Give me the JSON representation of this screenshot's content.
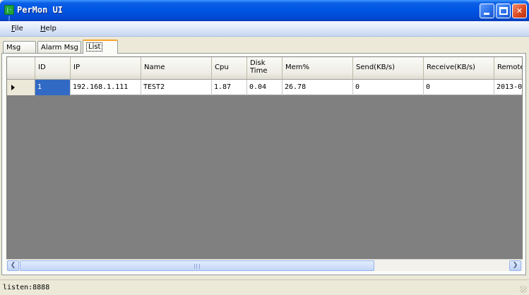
{
  "window": {
    "title": "PerMon UI",
    "icon_text": "|-|"
  },
  "menu": {
    "file": {
      "accel": "F",
      "rest": "ile"
    },
    "help": {
      "accel": "H",
      "rest": "elp"
    }
  },
  "tabs": [
    {
      "label": "Msg"
    },
    {
      "label": "Alarm Msg"
    },
    {
      "label": "List"
    }
  ],
  "grid": {
    "columns": [
      "ID",
      "IP",
      "Name",
      "Cpu",
      "Disk Time",
      "Mem%",
      "Send(KB/s)",
      "Receive(KB/s)",
      "Remote"
    ],
    "rows": [
      {
        "id": "1",
        "ip": "192.168.1.111",
        "name": "TEST2",
        "cpu": "1.87",
        "disk_time": "0.04",
        "mem": "26.78",
        "send": "0",
        "receive": "0",
        "remote": "2013-0"
      }
    ]
  },
  "status": {
    "text": "listen:8888"
  },
  "colors": {
    "titlebar": "#0054e3",
    "selection": "#316ac5",
    "grid_background": "#808080",
    "active_tab_accent": "#f7a62b"
  }
}
